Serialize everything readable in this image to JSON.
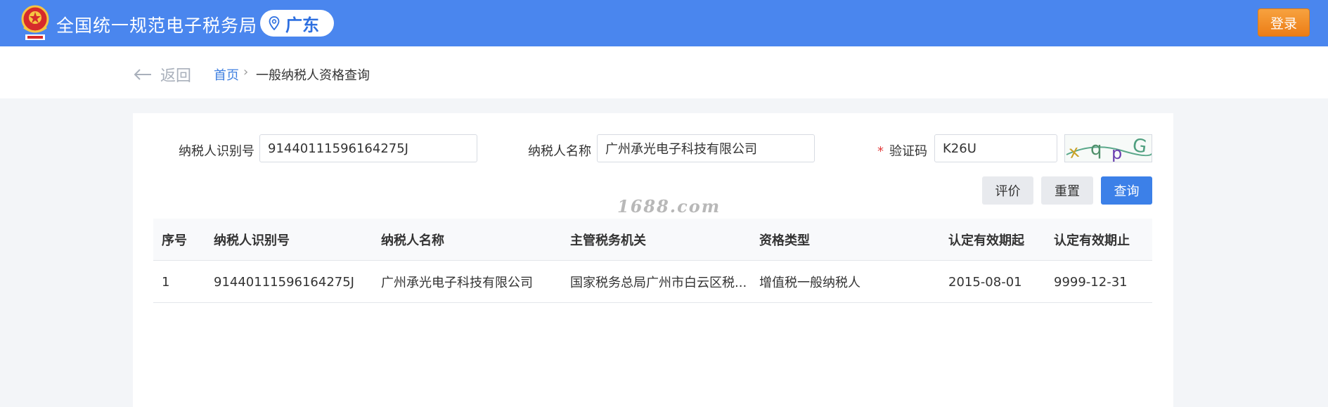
{
  "header": {
    "site_title": "全国统一规范电子税务局",
    "region": "广东",
    "login_label": "登录",
    "colors": {
      "bar": "#4a86ee",
      "login": "#ec7d16"
    }
  },
  "breadcrumb": {
    "back_label": "返回",
    "home": "首页",
    "separator": "›",
    "current": "一般纳税人资格查询"
  },
  "form": {
    "taxpayer_id_label": "纳税人识别号",
    "taxpayer_id_value": "91440111596164275J",
    "taxpayer_name_label": "纳税人名称",
    "taxpayer_name_value": "广州承光电子科技有限公司",
    "required_mark": "*",
    "captcha_label": "验证码",
    "captcha_value": "K26U",
    "captcha_image_text": "xqpG"
  },
  "buttons": {
    "rate": "评价",
    "reset": "重置",
    "query": "查询"
  },
  "watermark": "1688.com",
  "table": {
    "columns": [
      "序号",
      "纳税人识别号",
      "纳税人名称",
      "主管税务机关",
      "资格类型",
      "认定有效期起",
      "认定有效期止"
    ],
    "rows": [
      [
        "1",
        "91440111596164275J",
        "广州承光电子科技有限公司",
        "国家税务总局广州市白云区税...",
        "增值税一般纳税人",
        "2015-08-01",
        "9999-12-31"
      ]
    ]
  }
}
